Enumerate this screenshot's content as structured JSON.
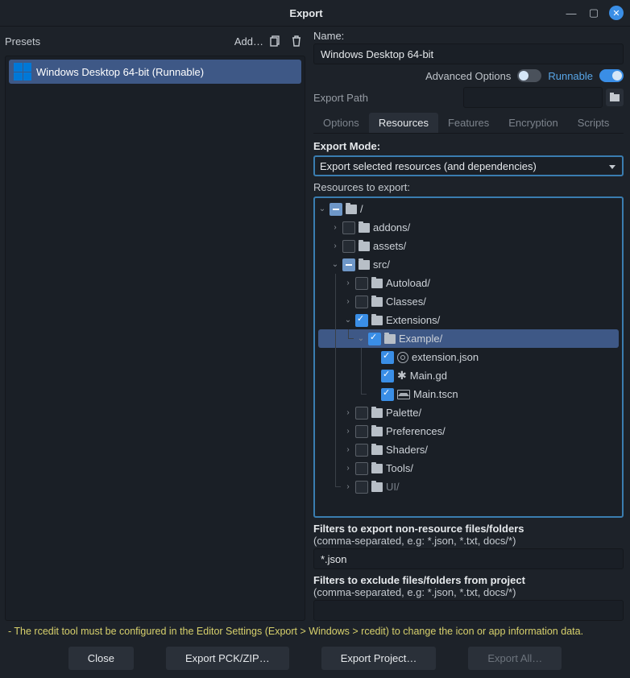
{
  "title": "Export",
  "presets": {
    "label": "Presets",
    "add": "Add…",
    "item": "Windows Desktop 64-bit (Runnable)"
  },
  "name": {
    "label": "Name:",
    "value": "Windows Desktop 64-bit"
  },
  "advopt": "Advanced Options",
  "runnable": "Runnable",
  "exportpath": "Export Path",
  "tabs": {
    "options": "Options",
    "resources": "Resources",
    "features": "Features",
    "encryption": "Encryption",
    "scripts": "Scripts"
  },
  "exportmode": {
    "label": "Export Mode:",
    "value": "Export selected resources (and dependencies)"
  },
  "resexp": "Resources to export:",
  "tree": {
    "root": "/",
    "addons": "addons/",
    "assets": "assets/",
    "src": "src/",
    "autoload": "Autoload/",
    "classes": "Classes/",
    "extensions": "Extensions/",
    "example": "Example/",
    "extjson": "extension.json",
    "maingd": "Main.gd",
    "maintscn": "Main.tscn",
    "palette": "Palette/",
    "prefs": "Preferences/",
    "shaders": "Shaders/",
    "tools": "Tools/",
    "ui": "UI/"
  },
  "filter1a": "Filters to export non-resource files/folders",
  "filter1b": "(comma-separated, e.g: *.json, *.txt, docs/*)",
  "filter1v": "*.json",
  "filter2a": "Filters to exclude files/folders from project",
  "filter2b": "(comma-separated, e.g: *.json, *.txt, docs/*)",
  "warning": "- The rcedit tool must be configured in the Editor Settings (Export > Windows > rcedit) to change the icon or app information data.",
  "buttons": {
    "close": "Close",
    "pck": "Export PCK/ZIP…",
    "project": "Export Project…",
    "all": "Export All…"
  }
}
